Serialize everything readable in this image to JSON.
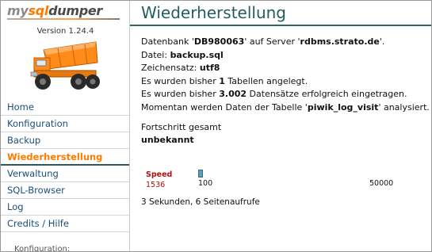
{
  "sidebar": {
    "logo": {
      "part1": "my",
      "part2": "sql",
      "part3": "dumper"
    },
    "version": "Version 1.24.4",
    "items": [
      {
        "label": "Home"
      },
      {
        "label": "Konfiguration"
      },
      {
        "label": "Backup"
      },
      {
        "label": "Wiederherstellung",
        "active": true
      },
      {
        "label": "Verwaltung"
      },
      {
        "label": "SQL-Browser"
      },
      {
        "label": "Log"
      },
      {
        "label": "Credits / Hilfe"
      }
    ],
    "extra": "Konfiguration:"
  },
  "main": {
    "title": "Wiederherstellung",
    "info": {
      "db_prefix": "Datenbank '",
      "db_name": "DB980063",
      "db_mid": "' auf Server '",
      "server": "rdbms.strato.de",
      "db_suffix": "'.",
      "file_label": "Datei: ",
      "file": "backup.sql",
      "charset_label": "Zeichensatz: ",
      "charset": "utf8",
      "tables_prefix": "Es wurden bisher ",
      "tables_count": "1",
      "tables_suffix": " Tabellen angelegt.",
      "records_prefix": "Es wurden bisher ",
      "records_count": "3.002",
      "records_suffix": " Datensätze erfolgreich eingetragen.",
      "current_prefix": "Momentan werden Daten der Tabelle '",
      "current_table": "piwik_log_visit",
      "current_suffix": "' analysiert."
    },
    "progress": {
      "label": "Fortschritt gesamt",
      "value": "unbekannt"
    },
    "speed": {
      "label": "Speed",
      "value": "1536",
      "min": "100",
      "max": "50000",
      "bar_color": "#5a9fb8"
    },
    "footer": "3 Sekunden, 6 Seitenaufrufe"
  },
  "colors": {
    "accent": "#ff7a00",
    "link": "#1a4f7a",
    "title": "#245d5d",
    "speed": "#b01010"
  }
}
